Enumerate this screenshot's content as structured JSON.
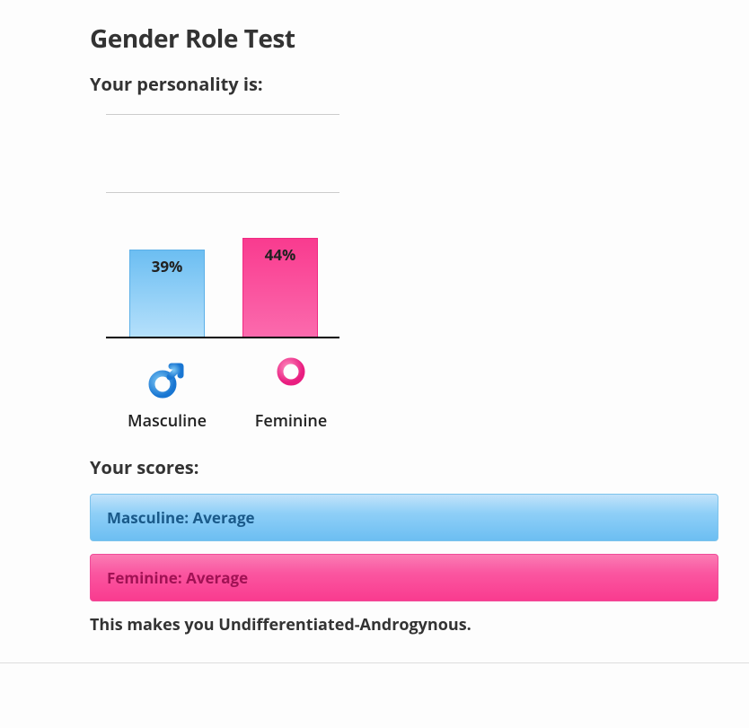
{
  "page_title": "Gender Role Test",
  "subtitle": "Your personality is:",
  "chart_data": {
    "type": "bar",
    "categories": [
      "Masculine",
      "Feminine"
    ],
    "values": [
      39,
      44
    ],
    "value_labels": [
      "39%",
      "44%"
    ],
    "ylim": [
      0,
      100
    ],
    "title": "",
    "xlabel": "",
    "ylabel": ""
  },
  "axis_labels": {
    "masculine": "Masculine",
    "feminine": "Feminine"
  },
  "scores_title": "Your scores:",
  "scores": {
    "masculine": "Masculine: Average",
    "feminine": "Feminine: Average"
  },
  "result": "This makes you Undifferentiated-Androgynous.",
  "colors": {
    "masculine": "#6cbef2",
    "feminine": "#f93b8f"
  }
}
